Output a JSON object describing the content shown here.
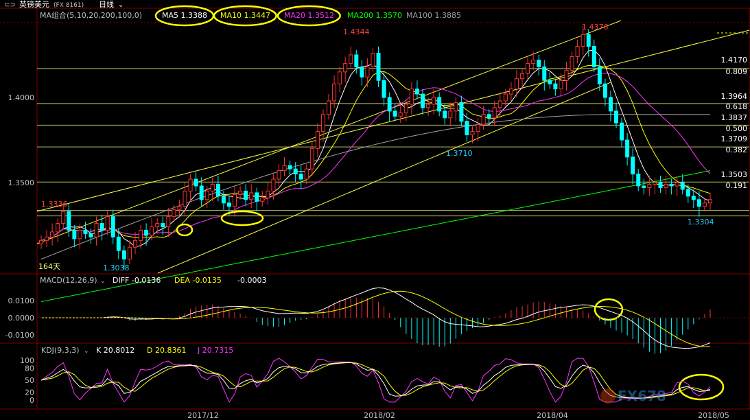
{
  "header": {
    "symbol_label": "英镑美元",
    "code_label": "(FX 8161)",
    "period_label": "日线",
    "icon": "chevron-down-icon"
  },
  "price_panel": {
    "ma_title": "MA组合(5,10,20,200,100,0)",
    "ma_values": [
      {
        "label": "MA5 1.3388",
        "color": "#ffffff",
        "circled": true
      },
      {
        "label": "MA10 1.3447",
        "color": "#ffff00",
        "circled": true
      },
      {
        "label": "MA20 1.3512",
        "color": "#ff33ff",
        "circled": true
      },
      {
        "label": "MA200 1.3570",
        "color": "#00ff00",
        "circled": false
      },
      {
        "label": "MA100 1.3885",
        "color": "#a0a0a0",
        "circled": false
      }
    ],
    "yaxis_labels": [
      "1.4000",
      "1.3500"
    ],
    "price_annotations": [
      {
        "text": "1.4344",
        "color": "#ff4040"
      },
      {
        "text": "1.4376",
        "color": "#ff4040"
      },
      {
        "text": "1.3336",
        "color": "#ff4040"
      },
      {
        "text": "1.3710",
        "color": "#20d0ff"
      },
      {
        "text": "1.3038",
        "color": "#20d0ff"
      },
      {
        "text": "1.3304",
        "color": "#20d0ff"
      },
      {
        "text": "164天",
        "color": "#ffff80"
      }
    ],
    "fib_levels": [
      {
        "price": "1.4170",
        "ratio": "0.809"
      },
      {
        "price": "1.3964",
        "ratio": "0.618"
      },
      {
        "price": "1.3837",
        "ratio": "0.500"
      },
      {
        "price": "1.3709",
        "ratio": "0.382"
      },
      {
        "price": "1.3503",
        "ratio": "0.191"
      }
    ]
  },
  "macd_panel": {
    "title": "MACD(12,26,9)",
    "diff": "DIFF -0.0136",
    "dea": "DEA -0.0135",
    "value": "-0.0003",
    "yaxis_labels": [
      "0.0100",
      "0.0000",
      "-0.0100"
    ]
  },
  "kdj_panel": {
    "title": "KDJ(9,3,3)",
    "k": "K 20.8012",
    "d": "D 20.8361",
    "j": "J 20.7315",
    "yaxis_labels": [
      "100",
      "80",
      "50",
      "20",
      "0"
    ]
  },
  "xaxis_labels": [
    "2017/12",
    "2018/02",
    "2018/04",
    "2018/05"
  ],
  "watermark": "FX678",
  "colors": {
    "up": "#ff3232",
    "down": "#00ffff",
    "grid": "#800000",
    "ma5": "#ffffff",
    "ma10": "#ffff00",
    "ma20": "#ff33ff",
    "ma200": "#00ff00",
    "ma100": "#a0a0a0"
  },
  "chart_data": {
    "type": "candlestick",
    "title": "英镑美元 (FX 8161) 日线",
    "ylim": [
      1.29,
      1.445
    ],
    "close_path": [
      1.316,
      1.318,
      1.321,
      1.326,
      1.333,
      1.322,
      1.317,
      1.322,
      1.32,
      1.318,
      1.326,
      1.322,
      1.33,
      1.318,
      1.31,
      1.305,
      1.312,
      1.316,
      1.322,
      1.319,
      1.324,
      1.326,
      1.324,
      1.33,
      1.334,
      1.336,
      1.345,
      1.352,
      1.348,
      1.34,
      1.345,
      1.349,
      1.342,
      1.338,
      1.336,
      1.343,
      1.345,
      1.34,
      1.344,
      1.339,
      1.341,
      1.345,
      1.352,
      1.357,
      1.36,
      1.358,
      1.355,
      1.352,
      1.358,
      1.37,
      1.38,
      1.39,
      1.398,
      1.408,
      1.415,
      1.42,
      1.425,
      1.418,
      1.412,
      1.418,
      1.426,
      1.41,
      1.4,
      1.392,
      1.389,
      1.391,
      1.396,
      1.405,
      1.402,
      1.394,
      1.396,
      1.4,
      1.392,
      1.388,
      1.392,
      1.397,
      1.386,
      1.378,
      1.38,
      1.384,
      1.39,
      1.388,
      1.394,
      1.398,
      1.402,
      1.405,
      1.411,
      1.414,
      1.42,
      1.422,
      1.418,
      1.41,
      1.408,
      1.405,
      1.41,
      1.416,
      1.424,
      1.43,
      1.437,
      1.43,
      1.418,
      1.408,
      1.4,
      1.392,
      1.385,
      1.375,
      1.365,
      1.355,
      1.348,
      1.347,
      1.349,
      1.35,
      1.347,
      1.349,
      1.348,
      1.35,
      1.346,
      1.342,
      1.34,
      1.336,
      1.338,
      1.34
    ]
  }
}
